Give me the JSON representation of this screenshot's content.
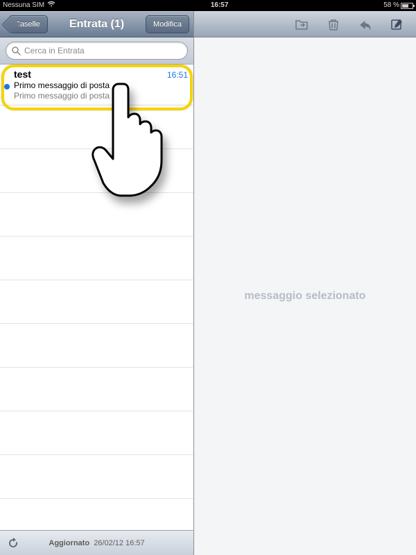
{
  "status_bar": {
    "carrier": "Nessuna SIM",
    "wifi_icon": "wifi-icon",
    "time": "16:57",
    "battery_pct": "58 %",
    "battery_icon": "battery-icon"
  },
  "sidebar": {
    "back_label": "Caselle",
    "title": "Entrata (1)",
    "edit_label": "Modifica",
    "search_placeholder": "Cerca in Entrata",
    "messages": [
      {
        "sender": "test",
        "time": "16:51",
        "subject": "Primo messaggio di posta",
        "preview": "Primo messaggio di posta",
        "unread": true
      }
    ],
    "footer": {
      "status_label": "Aggiornato",
      "status_value": "26/02/12 16:57",
      "refresh_icon": "refresh-icon"
    }
  },
  "content": {
    "toolbar": {
      "folder_icon": "folder-move-icon",
      "trash_icon": "trash-icon",
      "reply_icon": "reply-icon",
      "compose_icon": "compose-icon"
    },
    "empty_message": "messaggio selezionato"
  },
  "tutorial": {
    "highlight_target": "first-message",
    "pointer_icon": "hand-pointer-icon"
  },
  "colors": {
    "accent_blue": "#1e74e6",
    "highlight_yellow": "#f6d400",
    "nav_gradient_top": "#a8b4c4",
    "nav_gradient_bottom": "#6a7c93"
  }
}
